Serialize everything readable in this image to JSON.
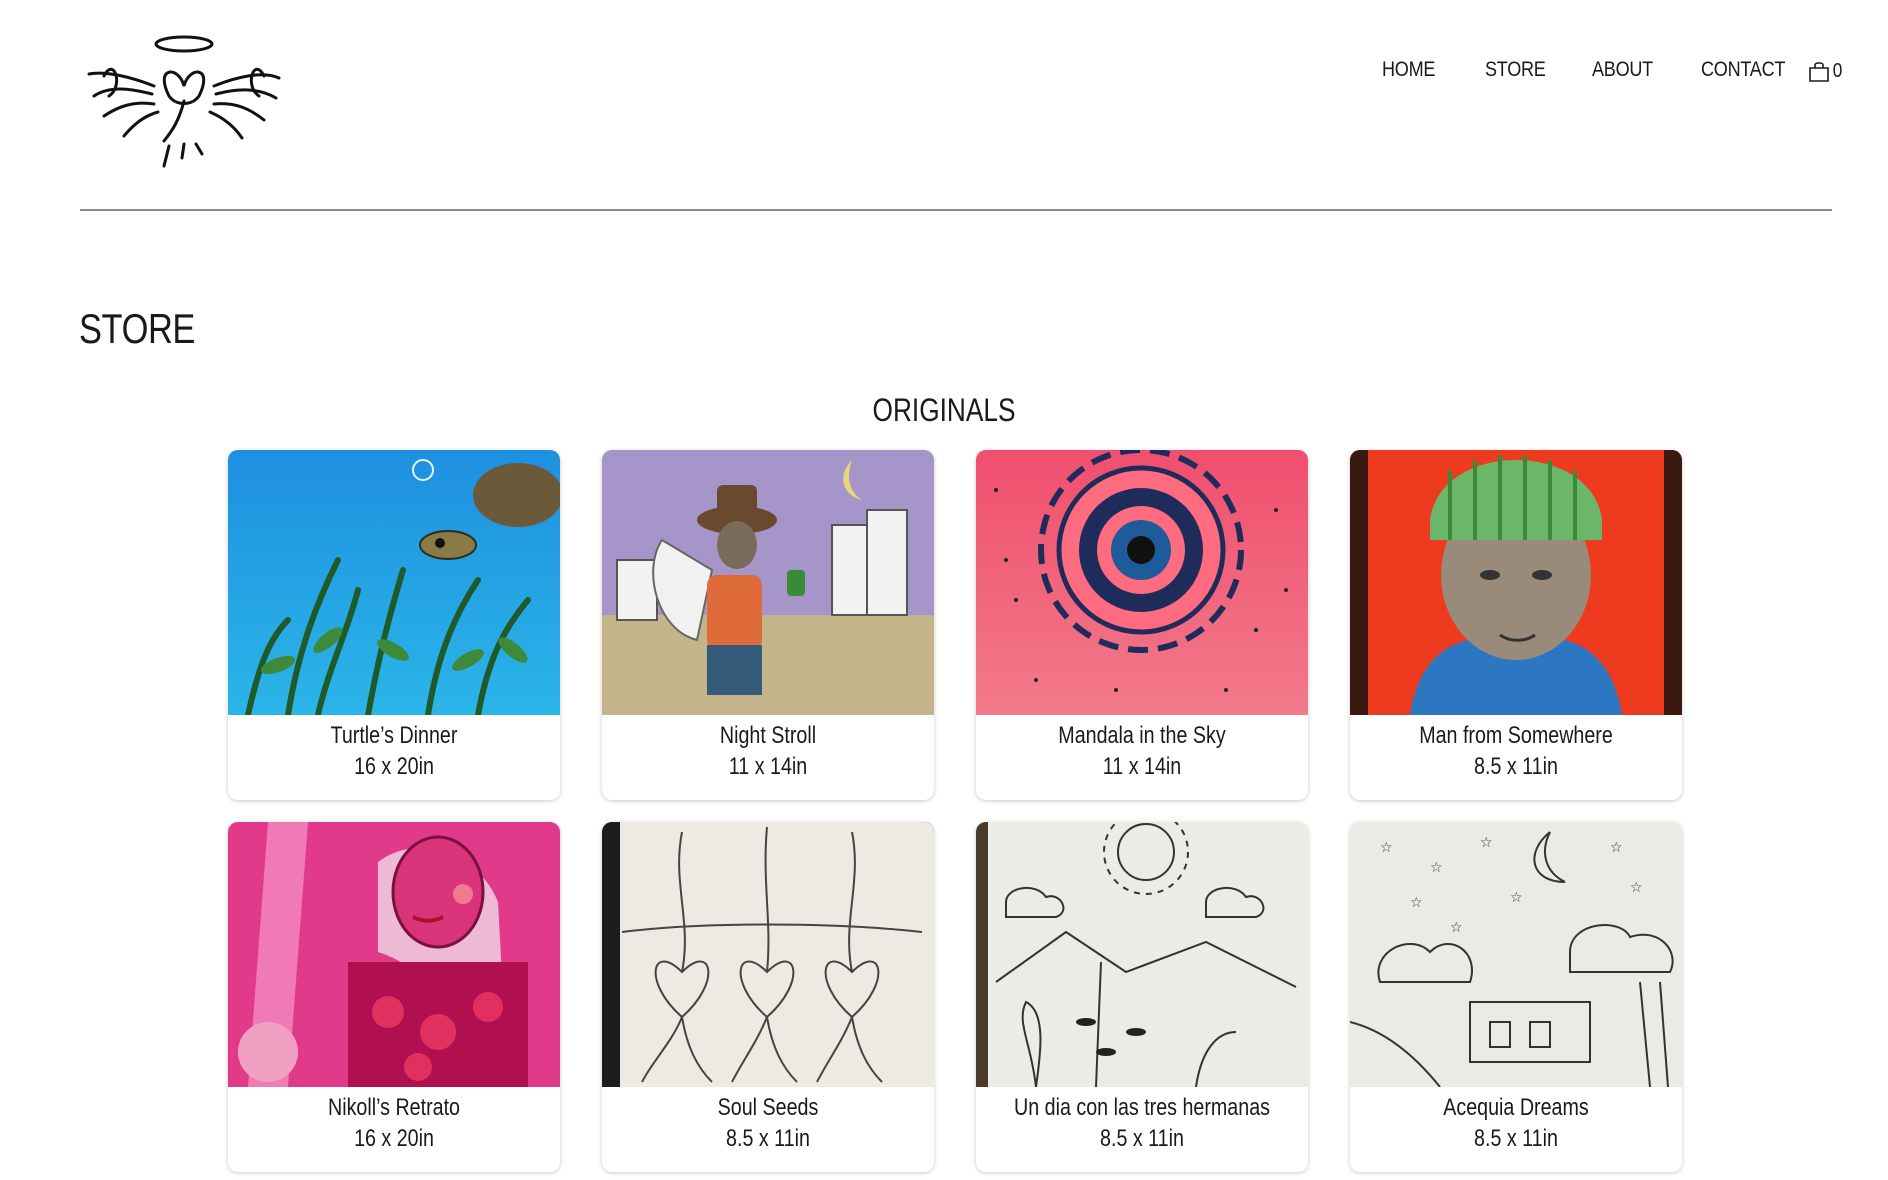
{
  "nav": {
    "items": [
      {
        "label": "HOME"
      },
      {
        "label": "STORE"
      },
      {
        "label": "ABOUT"
      },
      {
        "label": "CONTACT"
      }
    ],
    "cart_count": "0"
  },
  "page": {
    "title": "STORE",
    "section": "ORIGINALS"
  },
  "products": [
    {
      "title": "Turtle’s Dinner",
      "size": "16 x 20in"
    },
    {
      "title": "Night Stroll",
      "size": "11 x 14in"
    },
    {
      "title": "Mandala in the Sky",
      "size": "11 x 14in"
    },
    {
      "title": "Man from Somewhere",
      "size": "8.5 x 11in"
    },
    {
      "title": "Nikoll’s Retrato",
      "size": "16 x 20in"
    },
    {
      "title": "Soul Seeds",
      "size": "8.5 x 11in"
    },
    {
      "title": "Un dia con las tres hermanas",
      "size": "8.5 x 11in"
    },
    {
      "title": "Acequia Dreams",
      "size": "8.5 x 11in"
    }
  ],
  "colors": {
    "divider": "#8a8a8a",
    "text": "#1a1a1a"
  }
}
